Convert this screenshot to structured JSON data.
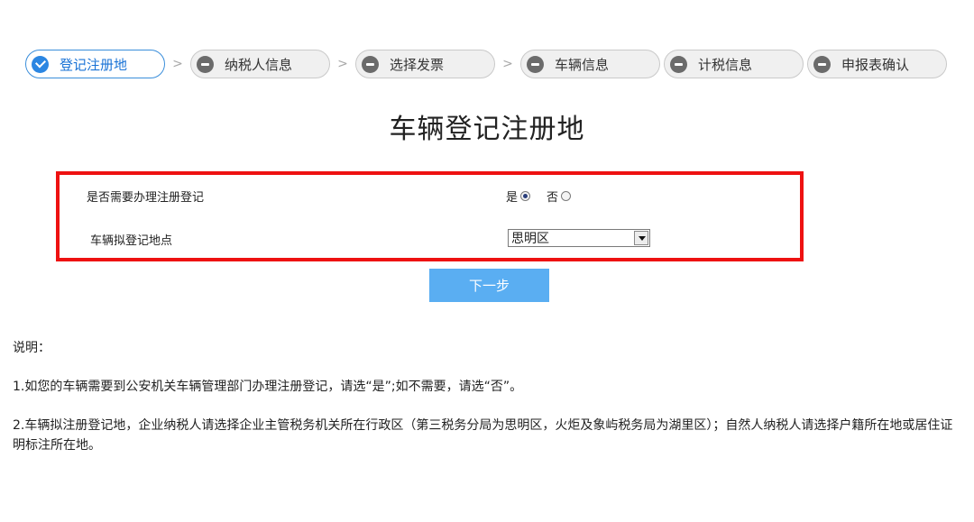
{
  "steps": [
    {
      "label": "登记注册地",
      "active": true
    },
    {
      "label": "纳税人信息",
      "active": false
    },
    {
      "label": "选择发票",
      "active": false
    },
    {
      "label": "车辆信息",
      "active": false
    },
    {
      "label": "计税信息",
      "active": false
    },
    {
      "label": "申报表确认",
      "active": false
    }
  ],
  "step_separator": ">",
  "page_title": "车辆登记注册地",
  "form": {
    "register_question": "是否需要办理注册登记",
    "option_yes": "是",
    "option_no": "否",
    "selected_option": "是",
    "location_label": "车辆拟登记地点",
    "location_value": "思明区"
  },
  "next_button": "下一步",
  "notes": {
    "heading": "说明：",
    "item1": "1.如您的车辆需要到公安机关车辆管理部门办理注册登记，请选“是”;如不需要，请选“否”。",
    "item2": "2.车辆拟注册登记地，企业纳税人请选择企业主管税务机关所在行政区（第三税务分局为思明区，火炬及象屿税务局为湖里区）；自然人纳税人请选择户籍所在地或居住证明标注所在地。"
  },
  "colors": {
    "accent": "#2b86e2",
    "highlight_border": "#ee1111",
    "button_bg": "#5aaef2"
  }
}
